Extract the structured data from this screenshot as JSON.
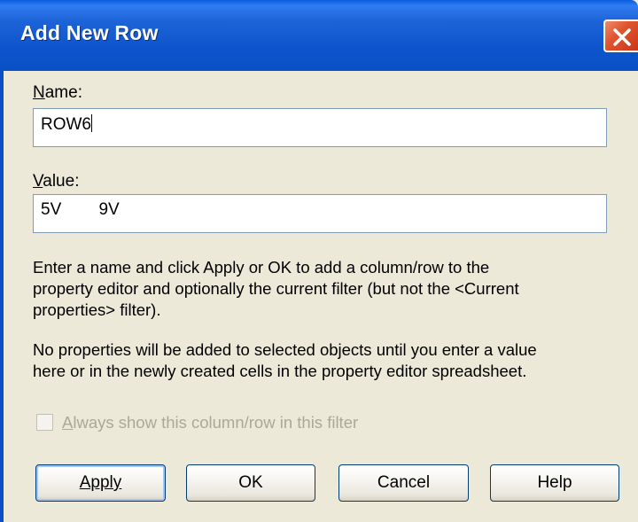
{
  "window": {
    "title": "Add New Row"
  },
  "name_field": {
    "label_access": "N",
    "label_rest": "ame:",
    "value": "ROW6"
  },
  "value_field": {
    "label_access": "V",
    "label_rest": "alue:",
    "value": "5V        9V"
  },
  "help_text": {
    "line1": "Enter a name and click Apply or OK to add a column/row to the",
    "line2": "property editor and optionally the current filter (but not the <Current",
    "line3": "properties> filter).",
    "line4": "No properties will be added to selected objects until you enter a value",
    "line5": "here or in the newly created cells in the property editor spreadsheet."
  },
  "checkbox": {
    "label_access": "A",
    "label_rest": "lways show this column/row in this filter",
    "checked": false,
    "enabled": false
  },
  "buttons": {
    "apply": "Apply",
    "ok": "OK",
    "cancel": "Cancel",
    "help": "Help"
  },
  "icons": {
    "close": "close-icon"
  },
  "colors": {
    "titlebar": "#0a4fc4",
    "close_button": "#e0552f",
    "dialog_bg": "#ece9d8",
    "field_border": "#7f9db9",
    "disabled_text": "#aca899"
  }
}
